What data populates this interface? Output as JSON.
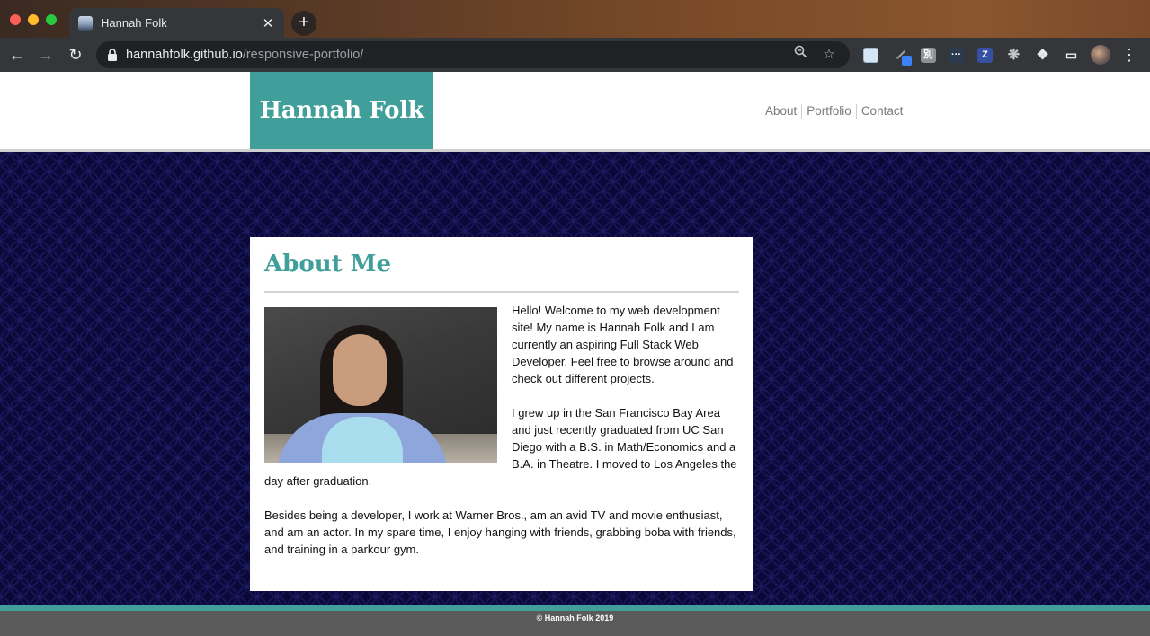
{
  "browser": {
    "tab_title": "Hannah Folk",
    "tab_close": "✕",
    "new_tab": "+",
    "url_host": "hannahfolk.github.io",
    "url_path": "/responsive-portfolio/"
  },
  "site": {
    "brand": "Hannah Folk",
    "nav": [
      "About",
      "Portfolio",
      "Contact"
    ],
    "section_title": "About Me",
    "paragraphs": [
      "Hello! Welcome to my web development site! My name is Hannah Folk and I am currently an aspiring Full Stack Web Developer. Feel free to browse around and check out different projects.",
      "I grew up in the San Francisco Bay Area and just recently graduated from UC San Diego with a B.S. in Math/Economics and a B.A. in Theatre. I moved to Los Angeles the day after graduation.",
      "Besides being a developer, I work at Warner Bros., am an avid TV and movie enthusiast, and am an actor. In my spare time, I enjoy hanging with friends, grabbing boba with friends, and training in a parkour gym."
    ],
    "footer": "© Hannah Folk 2019"
  },
  "colors": {
    "accent": "#409f9a",
    "background_pattern": "#0a0838",
    "footer": "#5a5a5a"
  },
  "icons": {
    "back": "arrow-left-icon",
    "forward": "arrow-right-icon",
    "reload": "reload-icon",
    "lock": "lock-icon",
    "zoom": "zoom-icon",
    "bookmark": "star-icon",
    "extensions": "puzzle-icon",
    "cast": "cast-icon",
    "menu": "kebab-menu-icon"
  }
}
